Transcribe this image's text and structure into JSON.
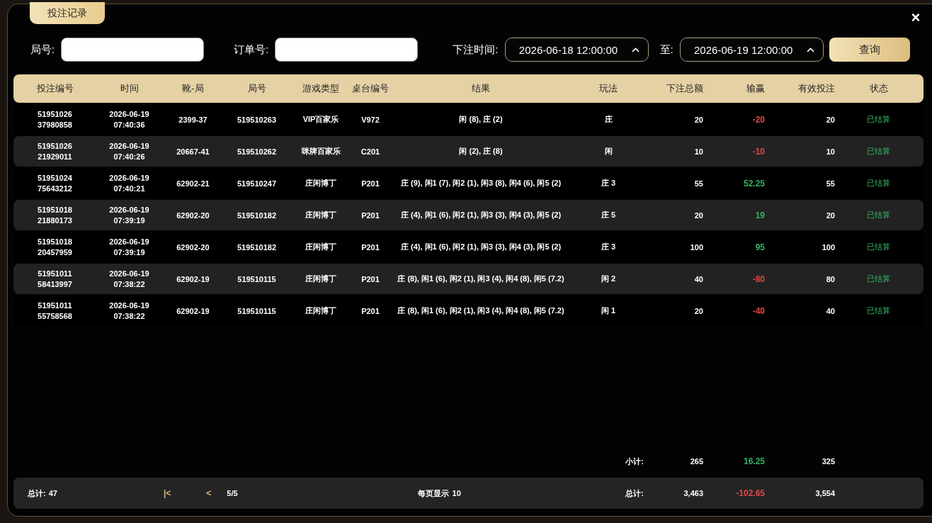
{
  "dialog": {
    "title_tab": "投注记录",
    "close": "×"
  },
  "filters": {
    "round_label": "局号:",
    "order_label": "订单号:",
    "time_label": "下注时间:",
    "time_from": "2026-06-18 12:00:00",
    "to_label": "至:",
    "time_to": "2026-06-19 12:00:00",
    "query_button": "查询"
  },
  "table": {
    "columns": [
      "投注编号",
      "时间",
      "靴-局",
      "局号",
      "游戏类型",
      "桌台编号",
      "结果",
      "玩法",
      "下注总额",
      "输赢",
      "有效投注",
      "状态"
    ],
    "rows": [
      {
        "bet_id": "5195102637980858",
        "time": "2026-06-19 07:40:36",
        "shoe_round": "2399-37",
        "round_no": "519510263",
        "game_type": "VIP百家乐",
        "table_no": "V972",
        "result": "闲 (8), 庄 (2)",
        "bet_type": "庄",
        "amount": "20",
        "win_loss": {
          "text": "-20",
          "color": "#e04848"
        },
        "valid": "20",
        "status": {
          "text": "已结算",
          "kind": "settled"
        }
      },
      {
        "bet_id": "5195102621929011",
        "time": "2026-06-19 07:40:26",
        "shoe_round": "20667-41",
        "round_no": "519510262",
        "game_type": "咪牌百家乐",
        "table_no": "C201",
        "result": "闲 (2), 庄 (8)",
        "bet_type": "闲",
        "amount": "10",
        "win_loss": {
          "text": "-10",
          "color": "#e04848"
        },
        "valid": "10",
        "status": {
          "text": "已结算",
          "kind": "settled"
        }
      },
      {
        "bet_id": "5195102475643212",
        "time": "2026-06-19 07:40:21",
        "shoe_round": "62902-21",
        "round_no": "519510247",
        "game_type": "庄闲博丁",
        "table_no": "P201",
        "result": "庄 (9), 闲1 (7), 闲2 (1), 闲3 (8), 闲4 (6), 闲5 (2)",
        "bet_type": "庄 3",
        "amount": "55",
        "win_loss": {
          "text": "52.25",
          "color": "#2fb463"
        },
        "valid": "55",
        "status": {
          "text": "已结算",
          "kind": "settled"
        }
      },
      {
        "bet_id": "5195101821880173",
        "time": "2026-06-19 07:39:19",
        "shoe_round": "62902-20",
        "round_no": "519510182",
        "game_type": "庄闲博丁",
        "table_no": "P201",
        "result": "庄 (4), 闲1 (6), 闲2 (1), 闲3 (3), 闲4 (3), 闲5 (2)",
        "bet_type": "庄 5",
        "amount": "20",
        "win_loss": {
          "text": "19",
          "color": "#2fb463"
        },
        "valid": "20",
        "status": {
          "text": "已结算",
          "kind": "settled"
        }
      },
      {
        "bet_id": "5195101820457959",
        "time": "2026-06-19 07:39:19",
        "shoe_round": "62902-20",
        "round_no": "519510182",
        "game_type": "庄闲博丁",
        "table_no": "P201",
        "result": "庄 (4), 闲1 (6), 闲2 (1), 闲3 (3), 闲4 (3), 闲5 (2)",
        "bet_type": "庄 3",
        "amount": "100",
        "win_loss": {
          "text": "95",
          "color": "#2fb463"
        },
        "valid": "100",
        "status": {
          "text": "已结算",
          "kind": "settled"
        }
      },
      {
        "bet_id": "5195101158413997",
        "time": "2026-06-19 07:38:22",
        "shoe_round": "62902-19",
        "round_no": "519510115",
        "game_type": "庄闲博丁",
        "table_no": "P201",
        "result": "庄 (8), 闲1 (6), 闲2 (1), 闲3 (4), 闲4 (8), 闲5 (7.2)",
        "bet_type": "闲 2",
        "amount": "40",
        "win_loss": {
          "text": "-80",
          "color": "#e04848"
        },
        "valid": "80",
        "status": {
          "text": "已结算",
          "kind": "settled"
        }
      },
      {
        "bet_id": "5195101155758568",
        "time": "2026-06-19 07:38:22",
        "shoe_round": "62902-19",
        "round_no": "519510115",
        "game_type": "庄闲博丁",
        "table_no": "P201",
        "result": "庄 (8), 闲1 (6), 闲2 (1), 闲3 (4), 闲4 (8), 闲5 (7.2)",
        "bet_type": "闲 1",
        "amount": "20",
        "win_loss": {
          "text": "-40",
          "color": "#e04848"
        },
        "valid": "40",
        "status": {
          "text": "已结算",
          "kind": "settled"
        }
      }
    ]
  },
  "subtotal": {
    "label": "小计:",
    "amount": "265",
    "win_loss": {
      "text": "16.25",
      "color": "#2fb463"
    },
    "valid": "325"
  },
  "footer": {
    "count_label": "总计:",
    "count": "47",
    "first_page": "|<",
    "prev_page": "<",
    "page": "5/5",
    "per_page_label": "每页显示",
    "per_page": "10",
    "total_label": "总计:",
    "amount": "3,463",
    "win_loss": {
      "text": "-102.65",
      "color": "#e04848"
    },
    "valid": "3,554"
  }
}
